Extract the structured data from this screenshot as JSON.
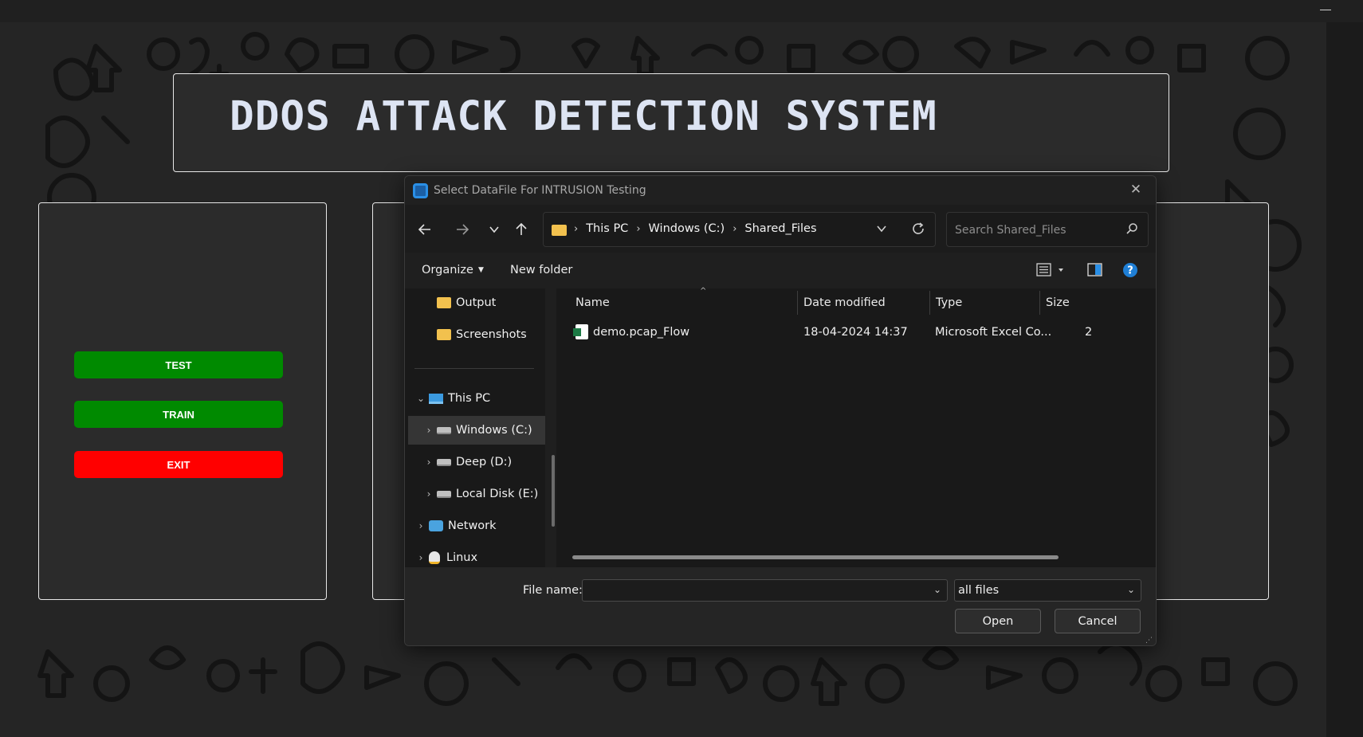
{
  "app": {
    "title": "DDOS ATTACK DETECTION SYSTEM",
    "buttons": [
      {
        "label": "TEST",
        "color": "#008a00"
      },
      {
        "label": "TRAIN",
        "color": "#008a00"
      },
      {
        "label": "EXIT",
        "color": "#ff0000"
      }
    ]
  },
  "dialog": {
    "title": "Select DataFile For INTRUSION Testing",
    "breadcrumb": [
      "This PC",
      "Windows (C:)",
      "Shared_Files"
    ],
    "search_placeholder": "Search Shared_Files",
    "commands": {
      "organize": "Organize",
      "new_folder": "New folder"
    },
    "nav_items": [
      {
        "label": "Output",
        "icon": "folder-icon"
      },
      {
        "label": "Screenshots",
        "icon": "folder-icon"
      },
      {
        "label": "This PC",
        "icon": "computer-icon"
      },
      {
        "label": "Windows (C:)",
        "icon": "drive-icon"
      },
      {
        "label": "Deep (D:)",
        "icon": "drive-icon"
      },
      {
        "label": "Local Disk (E:)",
        "icon": "drive-icon"
      },
      {
        "label": "Network",
        "icon": "network-icon"
      },
      {
        "label": "Linux",
        "icon": "linux-icon"
      }
    ],
    "columns": [
      "Name",
      "Date modified",
      "Type",
      "Size"
    ],
    "files": [
      {
        "name": "demo.pcap_Flow",
        "date": "18-04-2024 14:37",
        "type": "Microsoft Excel Co...",
        "size": "2"
      }
    ],
    "file_name_label": "File name:",
    "file_name_value": "",
    "filter_value": "all files",
    "open_label": "Open",
    "cancel_label": "Cancel"
  },
  "colors": {
    "accent": "#2a8fe6",
    "green_button": "#008a00",
    "red_button": "#ff0000",
    "title_text": "#dde4f3"
  }
}
